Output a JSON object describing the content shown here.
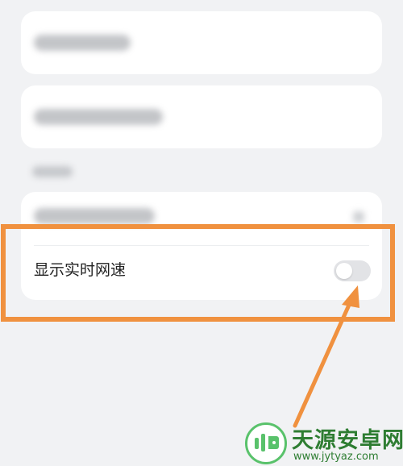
{
  "settings": {
    "network_speed_label": "显示实时网速",
    "network_speed_enabled": false
  },
  "watermark": {
    "title": "天源安卓网",
    "url": "www.jytyaz.com"
  },
  "colors": {
    "highlight": "#f0913f",
    "toggle_off": "#e2e3e6",
    "brand_green": "#2e7d32"
  }
}
